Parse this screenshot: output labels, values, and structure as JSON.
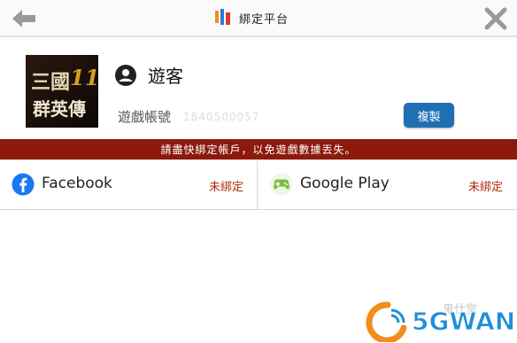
{
  "header": {
    "title": "綁定平台",
    "back_icon": "arrow-left-icon",
    "close_icon": "close-x-icon"
  },
  "profile": {
    "user_icon": "user-circle-icon",
    "username": "遊客",
    "account_label": "遊戲帳號",
    "account_id": "1840500057",
    "copy_label": "複製",
    "avatar_text": "三國 11 群英傳"
  },
  "warning": {
    "text": "請盡快綁定帳戶，以免遊戲數據丟失。"
  },
  "platforms": [
    {
      "name": "Facebook",
      "status": "未綁定",
      "icon": "facebook-icon"
    },
    {
      "name": "Google Play",
      "status": "未綁定",
      "icon": "gamepad-icon"
    }
  ],
  "watermark": {
    "brand": "5GWAN",
    "faint": "鬼仕堂"
  },
  "colors": {
    "warning_bg": "#8c1a0c",
    "copy_button": "#1f6fb2",
    "status_text": "#b02a0a",
    "watermark": "#1e8fd8"
  }
}
